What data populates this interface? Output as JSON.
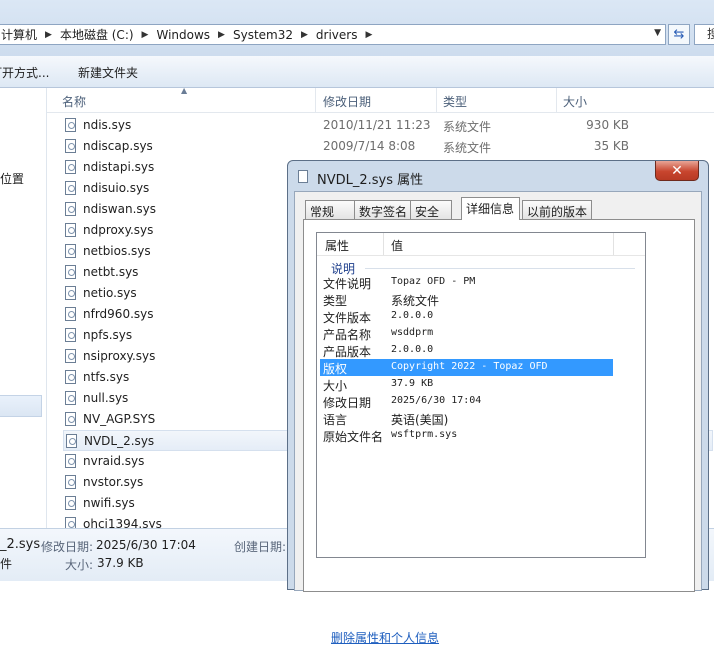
{
  "explorer": {
    "breadcrumbs": [
      "计算机",
      "本地磁盘 (C:)",
      "Windows",
      "System32",
      "drivers"
    ],
    "search_placeholder": "搜",
    "commands": [
      "打开方式...",
      "新建文件夹"
    ],
    "nav_location_label": "位置",
    "columns": {
      "name": "名称",
      "date": "修改日期",
      "type": "类型",
      "size": "大小"
    },
    "files": [
      {
        "name": "ndis.sys",
        "date": "2010/11/21 11:23",
        "type": "系统文件",
        "size": "930 KB"
      },
      {
        "name": "ndiscap.sys",
        "date": "2009/7/14 8:08",
        "type": "系统文件",
        "size": "35 KB"
      },
      {
        "name": "ndistapi.sys",
        "date": "",
        "type": "",
        "size": ""
      },
      {
        "name": "ndisuio.sys",
        "date": "",
        "type": "",
        "size": ""
      },
      {
        "name": "ndiswan.sys",
        "date": "",
        "type": "",
        "size": ""
      },
      {
        "name": "ndproxy.sys",
        "date": "",
        "type": "",
        "size": ""
      },
      {
        "name": "netbios.sys",
        "date": "",
        "type": "",
        "size": ""
      },
      {
        "name": "netbt.sys",
        "date": "",
        "type": "",
        "size": ""
      },
      {
        "name": "netio.sys",
        "date": "",
        "type": "",
        "size": ""
      },
      {
        "name": "nfrd960.sys",
        "date": "",
        "type": "",
        "size": ""
      },
      {
        "name": "npfs.sys",
        "date": "",
        "type": "",
        "size": ""
      },
      {
        "name": "nsiproxy.sys",
        "date": "",
        "type": "",
        "size": ""
      },
      {
        "name": "ntfs.sys",
        "date": "",
        "type": "",
        "size": ""
      },
      {
        "name": "null.sys",
        "date": "",
        "type": "",
        "size": ""
      },
      {
        "name": "NV_AGP.SYS",
        "date": "",
        "type": "",
        "size": ""
      },
      {
        "name": "NVDL_2.sys",
        "date": "",
        "type": "",
        "size": "",
        "selected": true
      },
      {
        "name": "nvraid.sys",
        "date": "",
        "type": "",
        "size": ""
      },
      {
        "name": "nvstor.sys",
        "date": "",
        "type": "",
        "size": ""
      },
      {
        "name": "nwifi.sys",
        "date": "",
        "type": "",
        "size": ""
      },
      {
        "name": "ohci1394.sys",
        "date": "",
        "type": "",
        "size": ""
      }
    ],
    "details": {
      "name_fragment": "_2.sys",
      "type_fragment": "件",
      "modified_label": "修改日期:",
      "modified_value": "2025/6/30 17:04",
      "created_label": "创建日期:",
      "size_label": "大小:",
      "size_value": "37.9 KB"
    }
  },
  "dialog": {
    "title": "NVDL_2.sys 属性",
    "close_symbol": "✕",
    "tabs": [
      "常规",
      "数字签名",
      "安全",
      "详细信息",
      "以前的版本"
    ],
    "active_tab": "详细信息",
    "headers": {
      "property": "属性",
      "value": "值"
    },
    "group": "说明",
    "properties": [
      {
        "name": "文件说明",
        "value": "Topaz OFD - PM"
      },
      {
        "name": "类型",
        "value": "系统文件"
      },
      {
        "name": "文件版本",
        "value": "2.0.0.0"
      },
      {
        "name": "产品名称",
        "value": "wsddprm"
      },
      {
        "name": "产品版本",
        "value": "2.0.0.0"
      },
      {
        "name": "版权",
        "value": "Copyright  2022 - Topaz OFD",
        "selected": true
      },
      {
        "name": "大小",
        "value": "37.9 KB"
      },
      {
        "name": "修改日期",
        "value": "2025/6/30 17:04"
      },
      {
        "name": "语言",
        "value": "英语(美国)"
      },
      {
        "name": "原始文件名",
        "value": "wsftprm.sys"
      }
    ],
    "remove_link": "删除属性和个人信息"
  },
  "colors": {
    "selection": "#3399ff",
    "link": "#1f5fbf",
    "close_button": "#c8452e"
  }
}
